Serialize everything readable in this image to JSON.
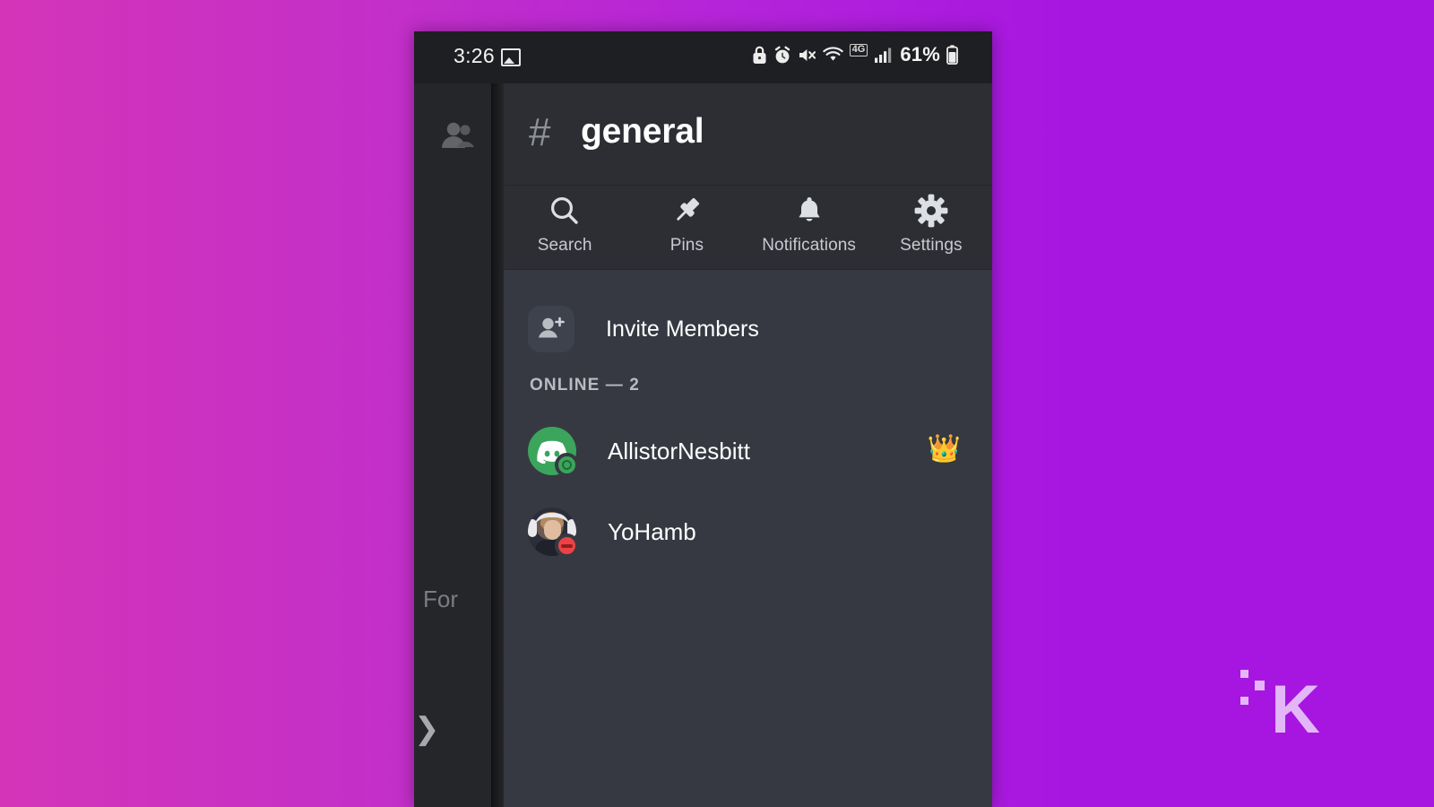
{
  "background": {
    "gradient_from": "#d434b8",
    "gradient_to": "#a616e0"
  },
  "status_bar": {
    "time": "3:26",
    "battery_percent": "61%",
    "network_label": "4G",
    "icons": [
      "image-icon",
      "lock-icon",
      "alarm-icon",
      "mute-icon",
      "wifi-icon",
      "network-4g-icon",
      "signal-bars-icon",
      "battery-icon"
    ]
  },
  "background_layer": {
    "people_icon": "people-icon",
    "partial_text": "For",
    "chevron": "❯"
  },
  "panel": {
    "header": {
      "hash": "#",
      "channel_name": "general"
    },
    "actions": [
      {
        "label": "Search",
        "icon": "search-icon"
      },
      {
        "label": "Pins",
        "icon": "pin-icon"
      },
      {
        "label": "Notifications",
        "icon": "bell-icon"
      },
      {
        "label": "Settings",
        "icon": "gear-icon"
      }
    ],
    "invite": {
      "label": "Invite Members",
      "icon": "person-add-icon"
    },
    "section_header": "ONLINE — 2",
    "members": [
      {
        "name": "AllistorNesbitt",
        "avatar_type": "discord-logo",
        "avatar_color": "#3ba55c",
        "status": "online",
        "badge": "👑",
        "badge_name": "crown-icon"
      },
      {
        "name": "YoHamb",
        "avatar_type": "photo",
        "status": "dnd",
        "badge": "",
        "badge_name": ""
      }
    ]
  },
  "cursor": {
    "type": "tap-hand-cursor",
    "color": "#cc2ce6"
  },
  "watermark": {
    "letter": "K",
    "color": "#e0b3f5"
  }
}
